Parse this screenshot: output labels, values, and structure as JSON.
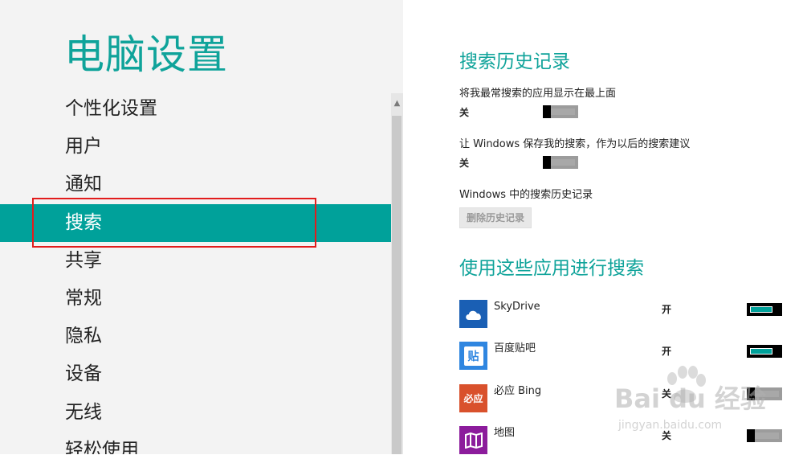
{
  "left": {
    "title": "电脑设置",
    "nav_items": [
      "个性化设置",
      "用户",
      "通知",
      "搜索",
      "共享",
      "常规",
      "隐私",
      "设备",
      "无线",
      "轻松使用"
    ],
    "selected_index": 3
  },
  "right": {
    "history_section": {
      "title": "搜索历史记录",
      "settings": [
        {
          "label": "将我最常搜索的应用显示在最上面",
          "state": "关",
          "on": false
        },
        {
          "label": "让 Windows 保存我的搜索，作为以后的搜索建议",
          "state": "关",
          "on": false
        }
      ],
      "history_label": "Windows 中的搜索历史记录",
      "clear_button": "删除历史记录"
    },
    "apps_section": {
      "title": "使用这些应用进行搜索",
      "apps": [
        {
          "name": "SkyDrive",
          "state": "开",
          "on": true,
          "icon": "cloud-icon",
          "color": "#1a5fb4"
        },
        {
          "name": "百度贴吧",
          "state": "开",
          "on": true,
          "icon": "tieba-icon",
          "color": "#2f86e0",
          "glyph": "贴"
        },
        {
          "name": "必应 Bing",
          "state": "关",
          "on": false,
          "icon": "bing-icon",
          "color": "#d9512c",
          "glyph": "必应"
        },
        {
          "name": "地图",
          "state": "关",
          "on": false,
          "icon": "map-icon",
          "color": "#8c1c9c"
        }
      ]
    }
  },
  "watermark": {
    "main": "Bai du 经验",
    "sub": "jingyan.baidu.com"
  },
  "colors": {
    "accent": "#00a19a",
    "title": "#0fa39a",
    "highlight": "#e21c1c"
  }
}
